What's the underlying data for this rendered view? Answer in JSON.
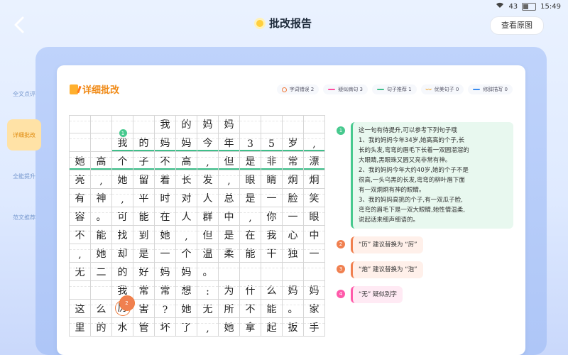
{
  "status": {
    "battery": "43",
    "time": "15:49"
  },
  "header": {
    "title": "批改报告",
    "view_original": "查看原图"
  },
  "sidebar": {
    "items": [
      {
        "label": "全文点评",
        "active": false
      },
      {
        "label": "详细批改",
        "active": true
      },
      {
        "label": "全能提升",
        "active": false
      },
      {
        "label": "范文推荐",
        "active": false
      }
    ]
  },
  "card": {
    "title": "详细批改",
    "legend": [
      {
        "label": "字词错误 2",
        "kind": "circle",
        "color": "#f07a3a"
      },
      {
        "label": "疑似病句 3",
        "kind": "line",
        "color": "#ff4fa0"
      },
      {
        "label": "句子推荐 1",
        "kind": "line",
        "color": "#3fbf8a"
      },
      {
        "label": "优美句子 0",
        "kind": "wave",
        "color": "#f0a020"
      },
      {
        "label": "修辞描写 0",
        "kind": "line",
        "color": "#3a8cf0"
      }
    ]
  },
  "essay": {
    "rows": [
      [
        "",
        "",
        "",
        "",
        "我",
        "的",
        "妈",
        "妈",
        "",
        "",
        "",
        ""
      ],
      [
        "",
        "",
        "我",
        "的",
        "妈",
        "妈",
        "今",
        "年",
        "3",
        "5",
        "岁",
        ","
      ],
      [
        "她",
        "高",
        "个",
        "子",
        "不",
        "高",
        ",",
        "但",
        "是",
        "非",
        "常",
        "漂"
      ],
      [
        "亮",
        ",",
        "她",
        "留",
        "着",
        "长",
        "发",
        ",",
        "眼",
        "睛",
        "炯",
        "炯"
      ],
      [
        "有",
        "神",
        ",",
        "平",
        "时",
        "对",
        "人",
        "总",
        "是",
        "一",
        "脸",
        "笑"
      ],
      [
        "容",
        "。",
        "可",
        "能",
        "在",
        "人",
        "群",
        "中",
        ",",
        "你",
        "一",
        "眼"
      ],
      [
        "不",
        "能",
        "找",
        "到",
        "她",
        ",",
        "但",
        "是",
        "在",
        "我",
        "心",
        "中"
      ],
      [
        ",",
        "她",
        "却",
        "是",
        "一",
        "个",
        "温",
        "柔",
        "能",
        "干",
        "独",
        "一"
      ],
      [
        "无",
        "二",
        "的",
        "好",
        "妈",
        "妈",
        "。",
        "",
        "",
        "",
        "",
        ""
      ],
      [
        "",
        "",
        "我",
        "常",
        "常",
        "想",
        ":",
        "为",
        "什",
        "么",
        "妈",
        "妈"
      ],
      [
        "这",
        "么",
        "厉",
        "害",
        "?",
        "她",
        "无",
        "所",
        "不",
        "能",
        "。",
        "家"
      ],
      [
        "里",
        "的",
        "水",
        "管",
        "坏",
        "了",
        ",",
        "她",
        "拿",
        "起",
        "扳",
        "手"
      ]
    ]
  },
  "notes": [
    {
      "num": "1",
      "type": "green",
      "lines": [
        "这一句有待提升,可以参考下列句子哦",
        "1、我的妈妈今年34岁,她高高的个子,长",
        "长的头发,弯弯的眉毛下长着一双圆溜溜的",
        "大眼睛,黑眼珠又圆又亮非常有神。",
        "2、我的妈妈今年大约40岁,她的个子不是",
        "很高,一头乌黑的长发,弯弯的柳叶眉下面",
        "有一双炯炯有神的眼睛。",
        "3、我的妈妈高挑的个子,有一双瓜子脸,",
        "弯弯的眉毛下是一双大眼睛,她性情温柔,",
        "说起话来细声细语的。"
      ]
    },
    {
      "num": "2",
      "type": "orange",
      "lines": [
        "“历” 建议替换为 “厉”"
      ]
    },
    {
      "num": "3",
      "type": "orange",
      "lines": [
        "“炮” 建议替换为 “泡”"
      ]
    },
    {
      "num": "4",
      "type": "pink",
      "lines": [
        "“无” 疑似别字"
      ]
    }
  ]
}
